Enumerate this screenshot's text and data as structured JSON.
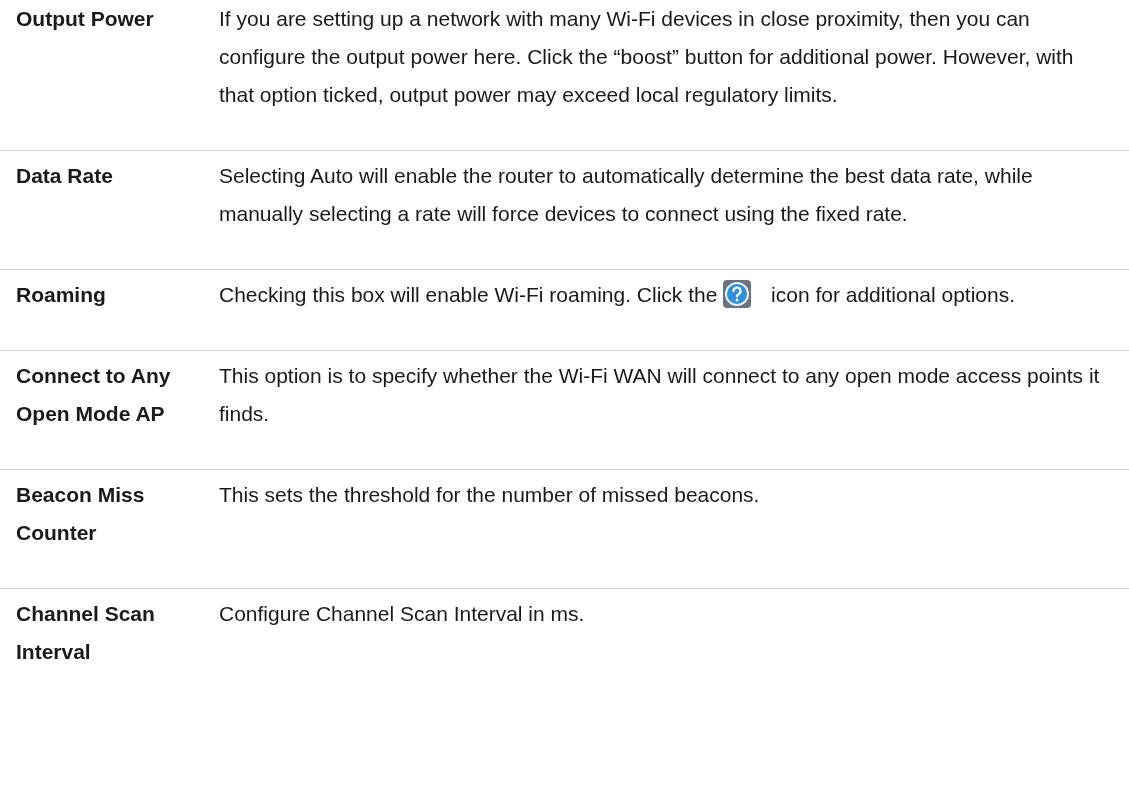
{
  "rows": [
    {
      "label": "Output Power",
      "description": [
        {
          "kind": "text",
          "text": "If you are setting up a network with many Wi-Fi devices in close proximity, then you can configure the output power here. Click the “boost” button for additional power. However, with that option ticked, output power may exceed local regulatory limits."
        }
      ]
    },
    {
      "label": "Data Rate",
      "description": [
        {
          "kind": "text",
          "text": "Selecting Auto will enable the router to automatically determine the best data rate, while manually selecting a rate will force devices to connect using the fixed rate."
        }
      ]
    },
    {
      "label": "Roaming",
      "description": [
        {
          "kind": "text",
          "text": "Checking this box will enable Wi-Fi roaming. Click the"
        },
        {
          "kind": "help_icon"
        },
        {
          "kind": "text",
          "text": "icon for additional options."
        }
      ]
    },
    {
      "label": "Connect to Any Open Mode AP",
      "description": [
        {
          "kind": "text",
          "text": "This option is to specify whether the Wi-Fi WAN will connect to any open mode access points it finds."
        }
      ]
    },
    {
      "label": "Beacon Miss Counter",
      "description": [
        {
          "kind": "text",
          "text": "This sets the threshold for the number of missed beacons."
        }
      ]
    },
    {
      "label": "Channel Scan Interval",
      "description": [
        {
          "kind": "text",
          "text": "Configure Channel Scan Interval in ms."
        }
      ]
    }
  ]
}
